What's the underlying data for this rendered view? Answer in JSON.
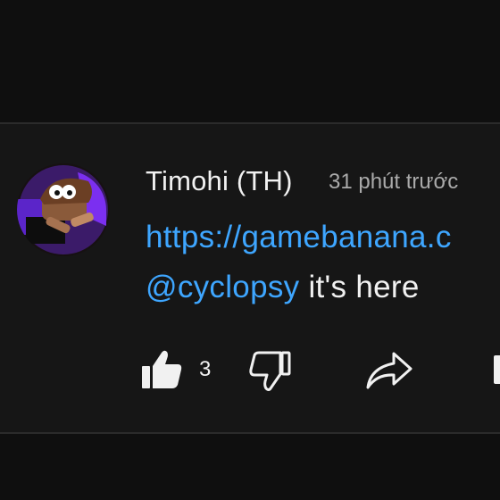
{
  "comment": {
    "author": "Timohi (TH)",
    "timestamp": "31 phút trước",
    "link_text": "https://gamebanana.c",
    "mention": "@cyclopsy",
    "text_after_mention": " it's here",
    "like_count": "3"
  },
  "icons": {
    "like": "thumbs-up-icon",
    "dislike": "thumbs-down-icon",
    "share": "share-icon",
    "more": "more-icon"
  },
  "colors": {
    "background": "#0f0f0f",
    "comment_background": "#161616",
    "link": "#3ea6ff",
    "text": "#f1f1f1",
    "secondary_text": "#aaaaaa",
    "avatar_accent": "#6a2bd6"
  }
}
